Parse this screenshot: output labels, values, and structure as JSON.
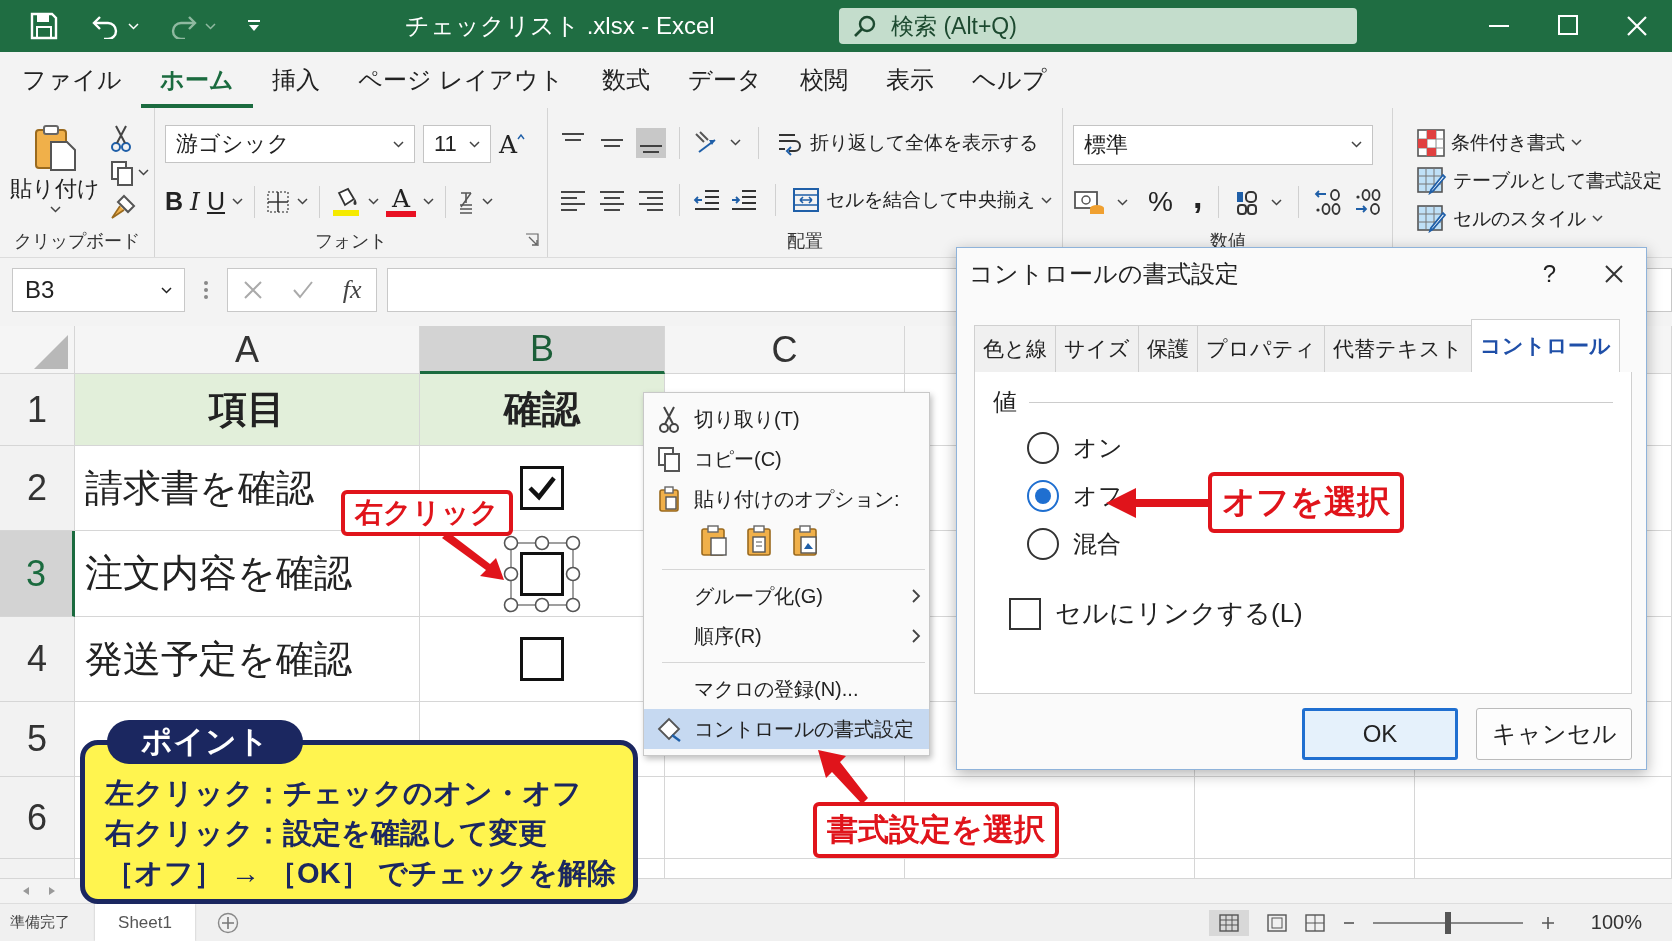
{
  "title_bar": {
    "title": "チェックリスト .xlsx  -  Excel",
    "search": {
      "placeholder": "検索 (Alt+Q)"
    }
  },
  "menu_tabs": [
    {
      "label": "ファイル",
      "selected": false
    },
    {
      "label": "ホーム",
      "selected": true
    },
    {
      "label": "挿入",
      "selected": false
    },
    {
      "label": "ページ レイアウト",
      "selected": false
    },
    {
      "label": "数式",
      "selected": false
    },
    {
      "label": "データ",
      "selected": false
    },
    {
      "label": "校閲",
      "selected": false
    },
    {
      "label": "表示",
      "selected": false
    },
    {
      "label": "ヘルプ",
      "selected": false
    }
  ],
  "ribbon": {
    "clipboard": {
      "paste": "貼り付け",
      "label": "クリップボード"
    },
    "font": {
      "name": "游ゴシック",
      "size": "11",
      "grow": "A",
      "bold": "B",
      "italic": "I",
      "underline": "U",
      "font_color_letter": "A",
      "label": "フォント"
    },
    "alignment": {
      "wrap": "折り返して全体を表示する",
      "merge": "セルを結合して中央揃え",
      "label": "配置"
    },
    "number": {
      "format": "標準",
      "percent": "%",
      "comma": ",",
      "label": "数値"
    },
    "styles": [
      {
        "label": "条件付き書式"
      },
      {
        "label": "テーブルとして書式設定"
      },
      {
        "label": "セルのスタイル"
      }
    ]
  },
  "formula_bar": {
    "name_box": "B3",
    "fx": "fx"
  },
  "sheet": {
    "columns": [
      {
        "label": "A",
        "selected": false
      },
      {
        "label": "B",
        "selected": true
      },
      {
        "label": "C",
        "selected": false
      }
    ],
    "rows": [
      {
        "number": "1",
        "selected": false,
        "kind": "header",
        "item": "項目",
        "check": "確認"
      },
      {
        "number": "2",
        "selected": false,
        "kind": "checkbox",
        "item": "請求書を確認",
        "checked": true,
        "control_selected": false
      },
      {
        "number": "3",
        "selected": true,
        "kind": "checkbox",
        "item": "注文内容を確認",
        "checked": false,
        "control_selected": true
      },
      {
        "number": "4",
        "selected": false,
        "kind": "checkbox",
        "item": "発送予定を確認",
        "checked": false,
        "control_selected": false
      },
      {
        "number": "5",
        "selected": false,
        "kind": "empty"
      },
      {
        "number": "6",
        "selected": false,
        "kind": "empty"
      }
    ]
  },
  "context_menu": {
    "items": [
      {
        "kind": "command",
        "label": "切り取り(T)",
        "selected": false
      },
      {
        "kind": "command",
        "label": "コピー(C)",
        "selected": false
      },
      {
        "kind": "heading",
        "label": "貼り付けのオプション:"
      },
      {
        "kind": "paste_options"
      },
      {
        "kind": "separator"
      },
      {
        "kind": "submenu",
        "label": "グループ化(G)",
        "selected": false
      },
      {
        "kind": "submenu",
        "label": "順序(R)",
        "selected": false
      },
      {
        "kind": "separator"
      },
      {
        "kind": "command",
        "label": "マクロの登録(N)...",
        "selected": false
      },
      {
        "kind": "command",
        "label": "コントロールの書式設定",
        "selected": true
      }
    ]
  },
  "dialog": {
    "title": "コントロールの書式設定",
    "help": "?",
    "tabs": [
      {
        "label": "色と線",
        "selected": false
      },
      {
        "label": "サイズ",
        "selected": false
      },
      {
        "label": "保護",
        "selected": false
      },
      {
        "label": "プロパティ",
        "selected": false
      },
      {
        "label": "代替テキスト",
        "selected": false
      },
      {
        "label": "コントロール",
        "selected": true
      }
    ],
    "group_label": "値",
    "radios": [
      {
        "label": "オン",
        "selected": false
      },
      {
        "label": "オフ",
        "selected": true
      },
      {
        "label": "混合",
        "selected": false
      }
    ],
    "link_checkbox": {
      "label": "セルにリンクする(L)",
      "checked": false
    },
    "buttons": [
      {
        "label": "OK",
        "default": true
      },
      {
        "label": "キャンセル",
        "default": false
      }
    ]
  },
  "callouts": [
    {
      "text": "右クリック"
    },
    {
      "text": "書式設定を選択"
    },
    {
      "text": "オフを選択"
    }
  ],
  "point": {
    "title": "ポイント",
    "lines": [
      "左クリック：チェックのオン・オフ",
      "右クリック：設定を確認して変更",
      "［オフ］ → ［OK］ でチェックを解除"
    ]
  },
  "status_bar": {
    "status": "準備完了",
    "sheet_tab": "Sheet1",
    "zoom": {
      "level": 0.5,
      "reading": "100%"
    }
  }
}
